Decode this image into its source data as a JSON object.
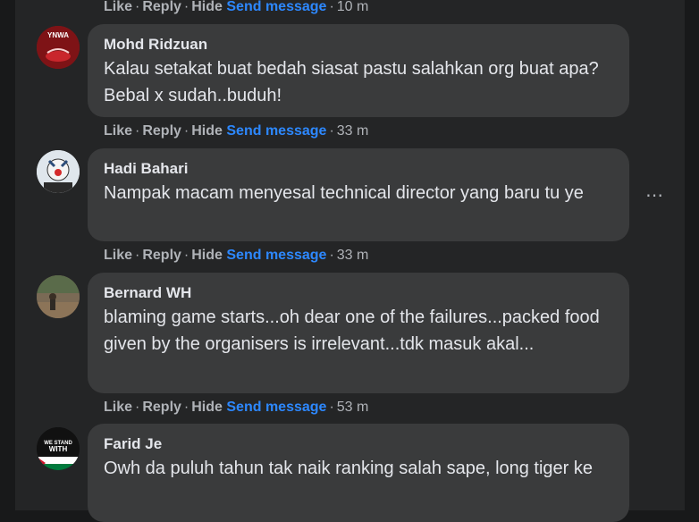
{
  "actions": {
    "like": "Like",
    "reply": "Reply",
    "hide": "Hide",
    "send": "Send message",
    "sep": "·"
  },
  "top_action_time": "10 m",
  "comments": [
    {
      "name": "Mohd Ridzuan",
      "avatar_text": "YNWA",
      "text": "Kalau setakat buat bedah siasat pastu salahkan org buat apa? Bebal x sudah..buduh!",
      "time": "33 m"
    },
    {
      "name": "Hadi Bahari",
      "text": "Nampak macam menyesal technical director yang baru tu ye",
      "time": "33 m"
    },
    {
      "name": "Bernard WH",
      "text": "blaming game starts...oh dear one of the failures...packed food given by the organisers is irrelevant...tdk masuk akal...",
      "time": "53 m"
    },
    {
      "name": "Farid Je",
      "avatar_text": "WE STAND WITH PALESTINE",
      "text": "Owh da puluh tahun tak naik ranking salah sape, long tiger ke"
    }
  ],
  "more_icon": "⋯",
  "colors": {
    "page_bg": "#18191a",
    "panel_bg": "#242526",
    "bubble_bg": "#3a3b3c",
    "text": "#e4e6eb",
    "muted": "#b0b3b8",
    "link": "#2d88ff"
  }
}
